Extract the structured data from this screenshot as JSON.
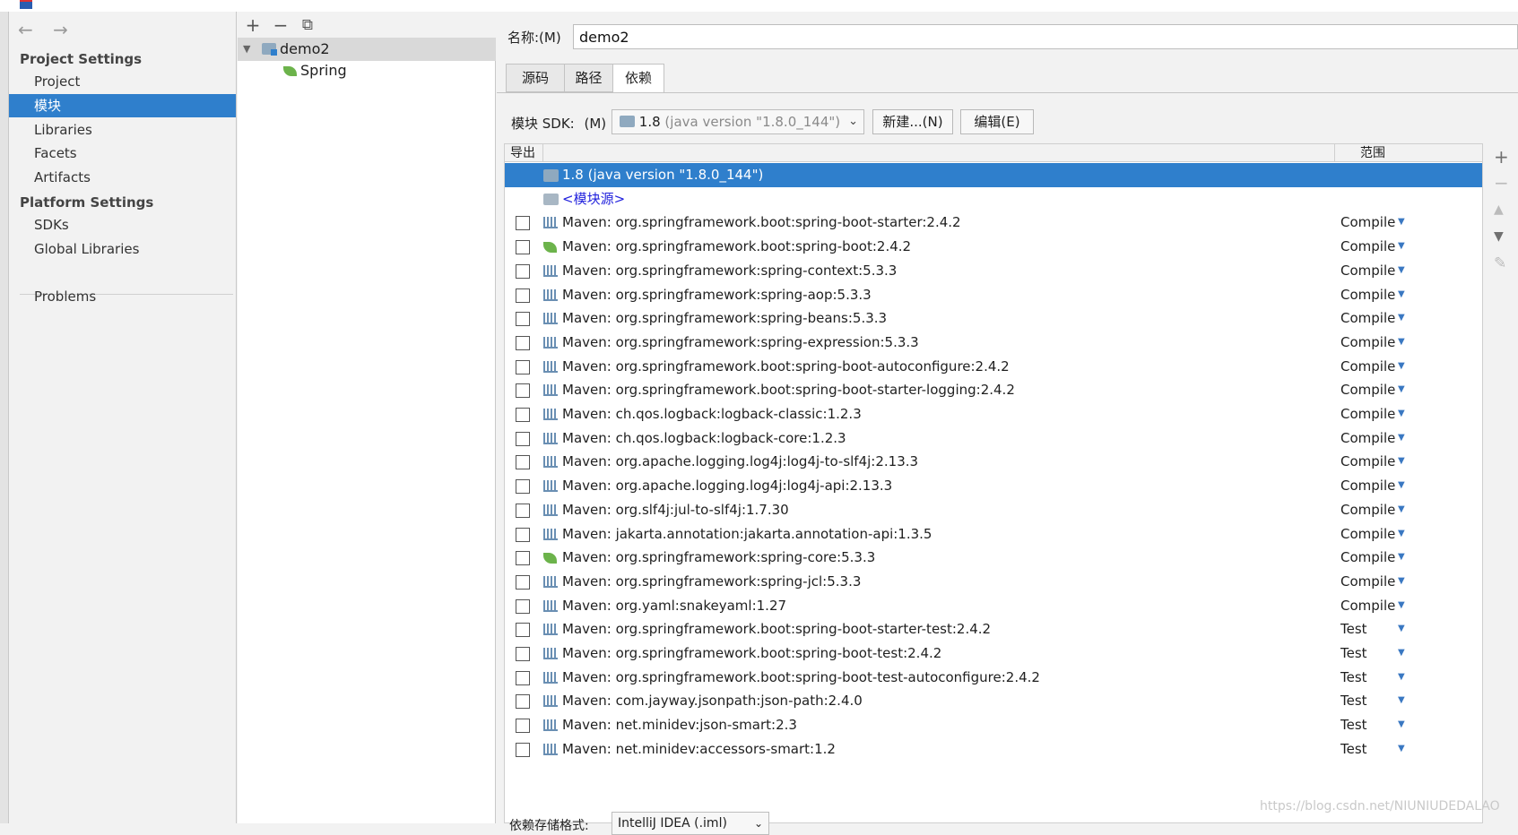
{
  "sidebar": {
    "back_icon": "←",
    "forward_icon": "→",
    "project_settings": "Project Settings",
    "project_items": [
      "Project",
      "模块",
      "Libraries",
      "Facets",
      "Artifacts"
    ],
    "platform_settings": "Platform Settings",
    "platform_items": [
      "SDKs",
      "Global Libraries"
    ],
    "problems": "Problems",
    "selected": "模块"
  },
  "tree": {
    "add_icon": "+",
    "remove_icon": "−",
    "copy_icon": "⧉",
    "module": "demo2",
    "facet": "Spring"
  },
  "main": {
    "name_label": "名称:(M)",
    "name_value": "demo2",
    "tabs": [
      "源码",
      "路径",
      "依赖"
    ],
    "active_tab": "依赖",
    "sdk_label": "模块 SDK:",
    "sdk_mnemonic": "(M)",
    "sdk_value": "1.8",
    "sdk_detail": "(java version \"1.8.0_144\")",
    "new_button": "新建...(N)",
    "edit_button": "编辑(E)",
    "col_export": "导出",
    "col_scope": "范围",
    "sdk_row": "1.8 (java version \"1.8.0_144\")",
    "module_source_row": "<模块源>",
    "dependencies": [
      {
        "name": "Maven: org.springframework.boot:spring-boot-starter:2.4.2",
        "scope": "Compile",
        "icon": "library-icon"
      },
      {
        "name": "Maven: org.springframework.boot:spring-boot:2.4.2",
        "scope": "Compile",
        "icon": "spring-icon"
      },
      {
        "name": "Maven: org.springframework:spring-context:5.3.3",
        "scope": "Compile",
        "icon": "library-icon"
      },
      {
        "name": "Maven: org.springframework:spring-aop:5.3.3",
        "scope": "Compile",
        "icon": "library-icon"
      },
      {
        "name": "Maven: org.springframework:spring-beans:5.3.3",
        "scope": "Compile",
        "icon": "library-icon"
      },
      {
        "name": "Maven: org.springframework:spring-expression:5.3.3",
        "scope": "Compile",
        "icon": "library-icon"
      },
      {
        "name": "Maven: org.springframework.boot:spring-boot-autoconfigure:2.4.2",
        "scope": "Compile",
        "icon": "library-icon"
      },
      {
        "name": "Maven: org.springframework.boot:spring-boot-starter-logging:2.4.2",
        "scope": "Compile",
        "icon": "library-icon"
      },
      {
        "name": "Maven: ch.qos.logback:logback-classic:1.2.3",
        "scope": "Compile",
        "icon": "library-icon"
      },
      {
        "name": "Maven: ch.qos.logback:logback-core:1.2.3",
        "scope": "Compile",
        "icon": "library-icon"
      },
      {
        "name": "Maven: org.apache.logging.log4j:log4j-to-slf4j:2.13.3",
        "scope": "Compile",
        "icon": "library-icon"
      },
      {
        "name": "Maven: org.apache.logging.log4j:log4j-api:2.13.3",
        "scope": "Compile",
        "icon": "library-icon"
      },
      {
        "name": "Maven: org.slf4j:jul-to-slf4j:1.7.30",
        "scope": "Compile",
        "icon": "library-icon"
      },
      {
        "name": "Maven: jakarta.annotation:jakarta.annotation-api:1.3.5",
        "scope": "Compile",
        "icon": "library-icon"
      },
      {
        "name": "Maven: org.springframework:spring-core:5.3.3",
        "scope": "Compile",
        "icon": "spring-icon"
      },
      {
        "name": "Maven: org.springframework:spring-jcl:5.3.3",
        "scope": "Compile",
        "icon": "library-icon"
      },
      {
        "name": "Maven: org.yaml:snakeyaml:1.27",
        "scope": "Compile",
        "icon": "library-icon"
      },
      {
        "name": "Maven: org.springframework.boot:spring-boot-starter-test:2.4.2",
        "scope": "Test",
        "icon": "library-icon"
      },
      {
        "name": "Maven: org.springframework.boot:spring-boot-test:2.4.2",
        "scope": "Test",
        "icon": "library-icon"
      },
      {
        "name": "Maven: org.springframework.boot:spring-boot-test-autoconfigure:2.4.2",
        "scope": "Test",
        "icon": "library-icon"
      },
      {
        "name": "Maven: com.jayway.jsonpath:json-path:2.4.0",
        "scope": "Test",
        "icon": "library-icon"
      },
      {
        "name": "Maven: net.minidev:json-smart:2.3",
        "scope": "Test",
        "icon": "library-icon"
      },
      {
        "name": "Maven: net.minidev:accessors-smart:1.2",
        "scope": "Test",
        "icon": "library-icon"
      }
    ],
    "side_tools": {
      "add": "+",
      "remove": "−",
      "up": "▲",
      "down": "▼",
      "edit": "✎"
    },
    "storage_label": "依赖存储格式:",
    "storage_value": "IntelliJ IDEA (.iml)"
  },
  "watermark": "https://blog.csdn.net/NIUNIUDEDALAO"
}
